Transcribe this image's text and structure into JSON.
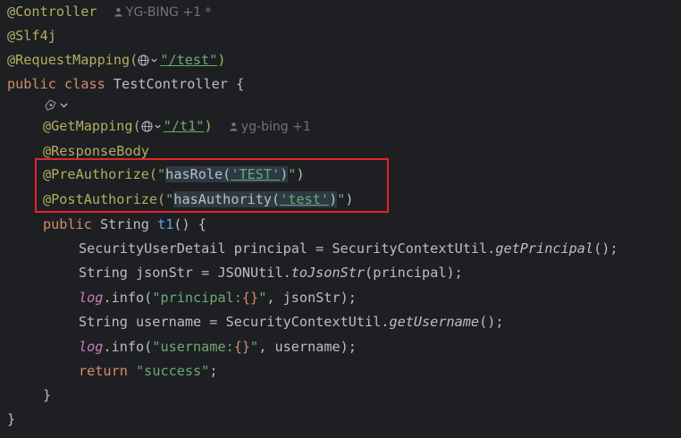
{
  "lines": {
    "l1": {
      "annotation": "@Controller",
      "hint_author": "YG-BING +1 *"
    },
    "l2": {
      "annotation": "@Slf4j"
    },
    "l3": {
      "annotation": "@RequestMapping(",
      "path": "\"/test\"",
      "close": ")"
    },
    "l4": {
      "kw1": "public",
      "kw2": "class",
      "name": "TestController",
      "brace": "{"
    },
    "l6": {
      "annotation": "@GetMapping(",
      "path": "\"/t1\"",
      "close": ")",
      "hint_author": "yg-bing +1"
    },
    "l7": {
      "annotation": "@ResponseBody"
    },
    "l8": {
      "annotation": "@PreAuthorize(",
      "q1": "\"",
      "expr_fn": "hasRole(",
      "expr_arg": "'TEST'",
      "expr_close": ")",
      "q2": "\"",
      "close": ")"
    },
    "l9": {
      "annotation": "@PostAuthorize(",
      "q1": "\"",
      "expr_fn": "hasAuthority(",
      "expr_arg": "'test'",
      "expr_close": ")",
      "q2": "\"",
      "close": ")"
    },
    "l10": {
      "kw": "public",
      "type": "String",
      "method": "t1",
      "rest": "() {"
    },
    "l11": {
      "pre": "SecurityUserDetail principal = SecurityContextUtil.",
      "call": "getPrincipal",
      "post": "();"
    },
    "l12": {
      "pre": "String jsonStr = JSONUtil.",
      "call": "toJsonStr",
      "post": "(principal);"
    },
    "l13": {
      "field": "log",
      "pre": ".info(",
      "str_a": "\"principal:",
      "str_b": "{}",
      "str_c": "\"",
      "post": ", jsonStr);"
    },
    "l14": {
      "pre": "String username = SecurityContextUtil.",
      "call": "getUsername",
      "post": "();"
    },
    "l15": {
      "field": "log",
      "pre": ".info(",
      "str_a": "\"username:",
      "str_b": "{}",
      "str_c": "\"",
      "post": ", username);"
    },
    "l16": {
      "kw": "return",
      "str": "\"success\"",
      "post": ";"
    },
    "l17": {
      "brace": "}"
    },
    "l18": {
      "brace": "}"
    }
  },
  "colors": {
    "background": "#1e1f22",
    "annotation": "#b3ae60",
    "keyword": "#cf8e6d",
    "string": "#6aab73",
    "method": "#56a8f5",
    "field": "#c77dbb",
    "highlight_box": "#e0262b"
  },
  "icons": {
    "globe": "globe-icon",
    "chevron": "chevron-down-icon",
    "user": "user-icon",
    "gutter": "endpoint-gutter-icon"
  }
}
